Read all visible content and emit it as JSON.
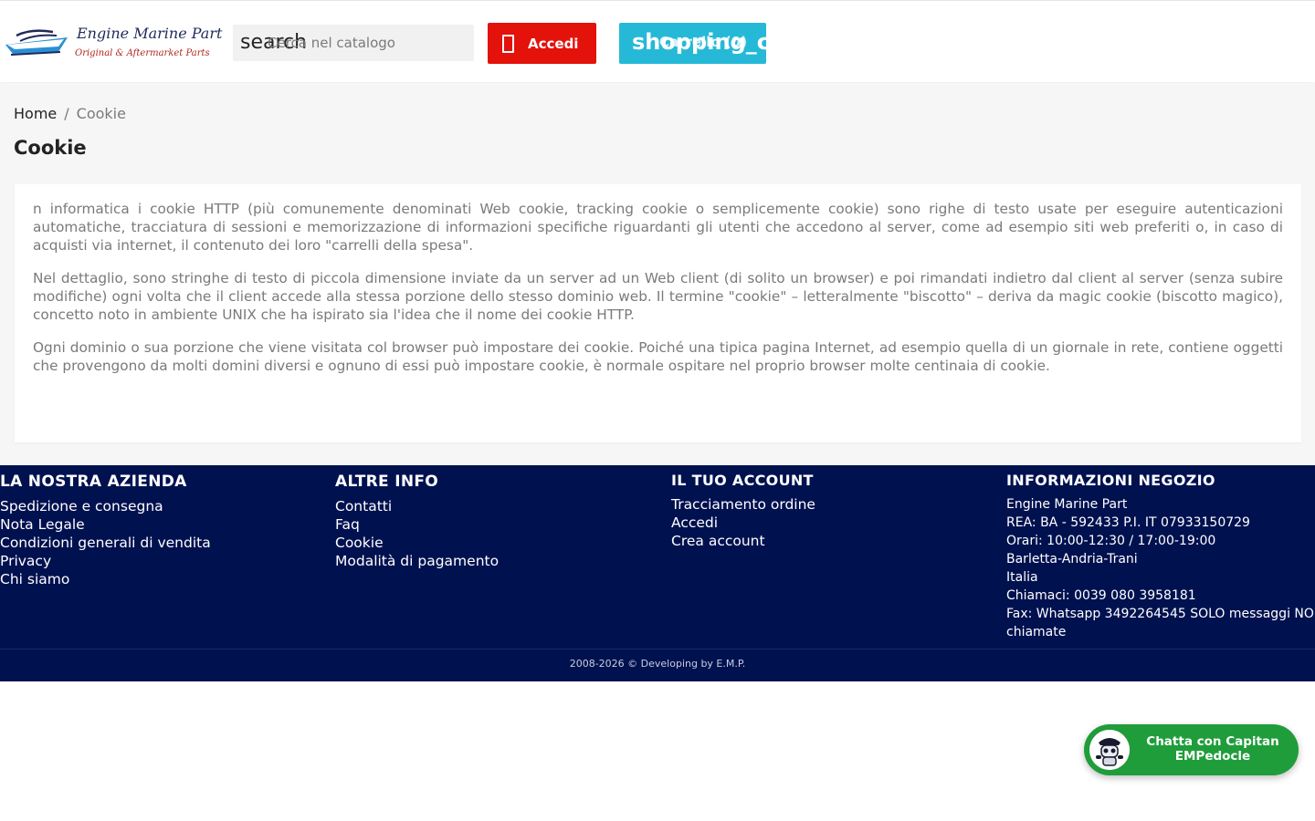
{
  "header": {
    "logo_title": "Engine Marine Part",
    "logo_subtitle": "Original & Aftermarket Parts",
    "search_icon_text": "search",
    "search_placeholder": "Cerca nel catalogo",
    "login_label": "Accedi",
    "cart_icon_text": "shopping_cart",
    "cart_label": "Carrello (0)"
  },
  "breadcrumb": {
    "home": "Home",
    "separator": "/",
    "current": "Cookie"
  },
  "page": {
    "title": "Cookie",
    "paragraphs": [
      "n informatica i cookie HTTP (più comunemente denominati Web cookie, tracking cookie o semplicemente cookie) sono righe di testo usate per eseguire autenticazioni automatiche, tracciatura di sessioni e memorizzazione di informazioni specifiche riguardanti gli utenti che accedono al server, come ad esempio siti web preferiti o, in caso di acquisti via internet, il contenuto dei loro \"carrelli della spesa\".",
      "Nel dettaglio, sono stringhe di testo di piccola dimensione inviate da un server ad un Web client (di solito un browser) e poi rimandati indietro dal client al server (senza subire modifiche) ogni volta che il client accede alla stessa porzione dello stesso dominio web. Il termine \"cookie\" – letteralmente \"biscotto\" – deriva da magic cookie (biscotto magico), concetto noto in ambiente UNIX che ha ispirato sia l'idea che il nome dei cookie HTTP.",
      "Ogni dominio o sua porzione che viene visitata col browser può impostare dei cookie. Poiché una tipica pagina Internet, ad esempio quella di un giornale in rete, contiene oggetti che provengono da molti domini diversi e ognuno di essi può impostare cookie, è normale ospitare nel proprio browser molte centinaia di cookie."
    ]
  },
  "footer": {
    "company": {
      "title": "LA NOSTRA AZIENDA",
      "links": [
        "Spedizione e consegna",
        "Nota Legale",
        "Condizioni generali di vendita",
        "Privacy",
        "Chi siamo"
      ]
    },
    "more_info": {
      "title": "ALTRE INFO",
      "links": [
        "Contatti",
        "Faq",
        "Cookie",
        "Modalità di pagamento"
      ]
    },
    "account": {
      "title": "IL TUO ACCOUNT",
      "links": [
        "Tracciamento ordine",
        "Accedi",
        "Crea account"
      ]
    },
    "store": {
      "title": "INFORMAZIONI NEGOZIO",
      "lines": [
        "Engine Marine Part",
        "REA: BA - 592433 P.I. IT 07933150729",
        "Orari: 10:00-12:30 / 17:00-19:00",
        "Barletta-Andria-Trani",
        "Italia",
        "Chiamaci: 0039 080 3958181",
        "Fax: Whatsapp 3492264545 SOLO messaggi NO chiamate"
      ]
    },
    "copyright": "2008-2026 © Developing by E.M.P."
  },
  "chat": {
    "label": "Chatta con Capitan EMPedocle"
  },
  "colors": {
    "login_button": "#e3120b",
    "cart_button": "#25b9d7",
    "footer_bg": "#00114f",
    "chat_button": "#1f9d3a"
  }
}
